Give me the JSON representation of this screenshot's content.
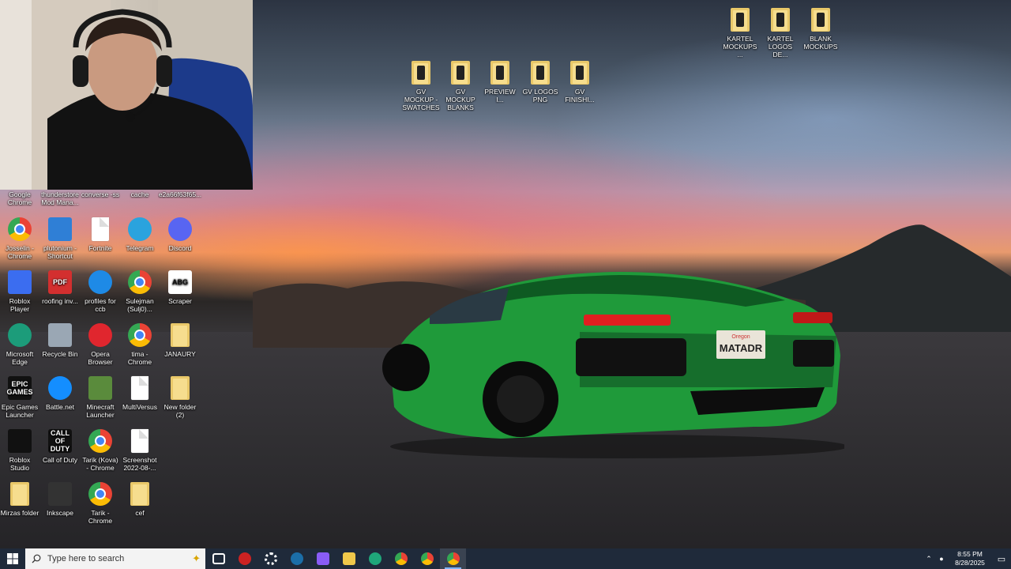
{
  "desktop_icons": {
    "top_right": [
      {
        "label": "KARTEL MOCKUPS ...",
        "icon": "folder-icon"
      },
      {
        "label": "KARTEL LOGOS DE...",
        "icon": "folder-icon"
      },
      {
        "label": "BLANK MOCKUPS",
        "icon": "folder-icon"
      }
    ],
    "top_middle": [
      {
        "label": "GV MOCKUP - SWATCHES",
        "icon": "folder-icon"
      },
      {
        "label": "GV MOCKUP BLANKS",
        "icon": "folder-icon"
      },
      {
        "label": "PREVIEW I...",
        "icon": "folder-icon"
      },
      {
        "label": "GV LOGOS PNG",
        "icon": "folder-icon"
      },
      {
        "label": "GV FINISHI...",
        "icon": "folder-icon"
      }
    ],
    "partial_row": [
      {
        "label": "Google Chrome"
      },
      {
        "label": "thunderstore Mod Mana..."
      },
      {
        "label": "converse -ss"
      },
      {
        "label": "cache"
      },
      {
        "label": "e2a66f63f65..."
      }
    ],
    "grid": [
      {
        "label": "Josselin - Chrome",
        "icon": "chrome-icon"
      },
      {
        "label": "plutonium - Shortcut",
        "icon": "plutonium-icon"
      },
      {
        "label": "Fortnite",
        "icon": "document-icon"
      },
      {
        "label": "Telegram",
        "icon": "telegram-icon"
      },
      {
        "label": "Discord",
        "icon": "discord-icon"
      },
      {
        "label": "Roblox Player",
        "icon": "roblox-icon"
      },
      {
        "label": "roofing inv...",
        "icon": "pdf-icon",
        "badge": "PDF"
      },
      {
        "label": "profiles for ccb",
        "icon": "ie-icon"
      },
      {
        "label": "Sulejman (Sulj0)...",
        "icon": "chrome-icon"
      },
      {
        "label": "Scraper",
        "icon": "abg-icon",
        "badge": "ABG"
      },
      {
        "label": "Microsoft Edge",
        "icon": "edge-icon"
      },
      {
        "label": "Recycle Bin",
        "icon": "recycle-bin-icon"
      },
      {
        "label": "Opera Browser",
        "icon": "opera-icon"
      },
      {
        "label": "tima - Chrome",
        "icon": "chrome-icon"
      },
      {
        "label": "JANAURY",
        "icon": "folder-icon"
      },
      {
        "label": "Epic Games Launcher",
        "icon": "epic-games-icon",
        "badge": "EPIC GAMES"
      },
      {
        "label": "Battle.net",
        "icon": "battlenet-icon"
      },
      {
        "label": "Minecraft Launcher",
        "icon": "minecraft-icon"
      },
      {
        "label": "MultiVersus",
        "icon": "document-icon"
      },
      {
        "label": "New folder (2)",
        "icon": "folder-icon"
      },
      {
        "label": "Roblox Studio",
        "icon": "roblox-studio-icon"
      },
      {
        "label": "Call of Duty",
        "icon": "call-of-duty-icon",
        "badge": "CALL OF DUTY"
      },
      {
        "label": "Tarik (Kova) - Chrome",
        "icon": "chrome-icon"
      },
      {
        "label": "Screenshot 2022-08-...",
        "icon": "screenshot-icon"
      },
      null,
      {
        "label": "Mirzas folder",
        "icon": "folder-icon"
      },
      {
        "label": "Inkscape",
        "icon": "inkscape-icon"
      },
      {
        "label": "Tarik - Chrome",
        "icon": "chrome-icon"
      },
      {
        "label": "cef",
        "icon": "folder-icon"
      },
      null
    ]
  },
  "wallpaper": {
    "license_plate": "MATADR",
    "plate_state": "Oregon"
  },
  "taskbar": {
    "search_placeholder": "Type here to search",
    "apps": [
      {
        "name": "task-view-icon",
        "color": "#ffffff"
      },
      {
        "name": "obs-icon",
        "color": "#cc2222"
      },
      {
        "name": "settings-icon",
        "color": "#ffffff"
      },
      {
        "name": "steam-icon",
        "color": "#1b6ea8"
      },
      {
        "name": "copilot-icon",
        "color": "#8a5cf6"
      },
      {
        "name": "file-explorer-icon",
        "color": "#f0c84a"
      },
      {
        "name": "edge-icon",
        "color": "#1fa67a"
      },
      {
        "name": "chrome-icon",
        "color": "#ea4335"
      },
      {
        "name": "chrome-profile-icon",
        "color": "#a259c4"
      },
      {
        "name": "chrome-active-icon",
        "color": "#ea4335"
      }
    ],
    "time": "8:55 PM",
    "date": "8/28/2025"
  }
}
